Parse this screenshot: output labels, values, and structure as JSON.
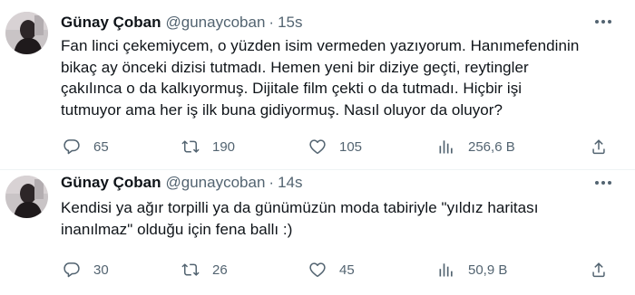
{
  "tweets": [
    {
      "author_name": "Günay Çoban",
      "author_handle": "@gunaycoban",
      "separator": "·",
      "time": "15s",
      "body_lines": [
        "Fan linci çekemiycem, o yüzden isim vermeden yazıyorum. Hanımefendinin",
        "bikaç ay önceki dizisi tutmadı. Hemen yeni bir diziye geçti, reytingler",
        "çakılınca o da kalkıyormuş. Dijitale film çekti o da tutmadı. Hiçbir işi",
        "tutmuyor ama her iş ilk buna gidiyormuş. Nasıl oluyor da oluyor?"
      ],
      "replies": "65",
      "retweets": "190",
      "likes": "105",
      "views": "256,6 B"
    },
    {
      "author_name": "Günay Çoban",
      "author_handle": "@gunaycoban",
      "separator": "·",
      "time": "14s",
      "body_lines": [
        "Kendisi ya ağır torpilli ya da günümüzün moda tabiriyle \"yıldız haritası",
        "inanılmaz\" olduğu için fena ballı :)"
      ],
      "replies": "30",
      "retweets": "26",
      "likes": "45",
      "views": "50,9 B"
    }
  ],
  "icons": {
    "reply": "reply-icon",
    "retweet": "retweet-icon",
    "like": "heart-icon",
    "views": "views-chart-icon",
    "share": "share-icon",
    "more": "more-options-icon"
  },
  "colors": {
    "text": "#0f1419",
    "secondary": "#536471",
    "divider": "#eff3f4"
  }
}
